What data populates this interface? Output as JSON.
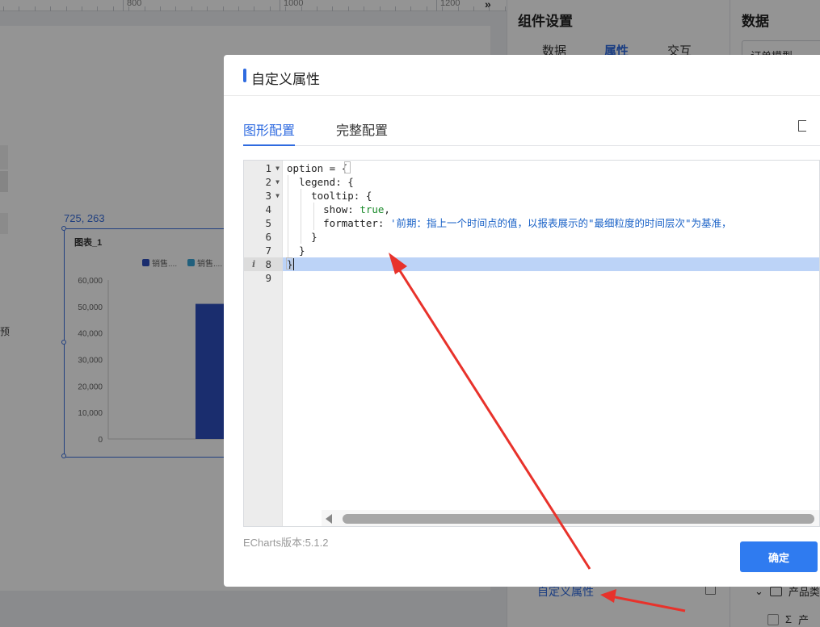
{
  "ruler": {
    "labels": [
      "800",
      "1000",
      "1200"
    ],
    "expand_icon": "»"
  },
  "canvas": {
    "left_cut_text": "预",
    "coord_label": "725, 263",
    "chart_title": "图表_1",
    "legend": [
      {
        "label": "销售....",
        "color": "#2e4fbd"
      },
      {
        "label": "销售....",
        "color": "#3aa6d8"
      }
    ]
  },
  "chart_data": {
    "type": "bar",
    "title": "图表_1",
    "yticks": [
      "60,000",
      "50,000",
      "40,000",
      "30,000",
      "20,000",
      "10,000",
      "0"
    ],
    "ylim": [
      0,
      60000
    ],
    "series": [
      {
        "name": "销售....",
        "color": "#2e4fbd",
        "values": [
          51000
        ]
      }
    ]
  },
  "right_panel": {
    "title": "组件设置",
    "tabs": [
      {
        "label": "数据",
        "active": false
      },
      {
        "label": "属性",
        "active": true
      },
      {
        "label": "交互",
        "active": false
      }
    ],
    "custom_prop_link": "自定义属性",
    "data_section": {
      "title": "数据",
      "dataset_select": "订单模型",
      "tree_row_1": "产品类",
      "tree_row_2": "产"
    }
  },
  "modal": {
    "title": "自定义属性",
    "tabs": [
      {
        "label": "图形配置",
        "active": true
      },
      {
        "label": "完整配置",
        "active": false
      }
    ],
    "code_lines": [
      "option = {",
      "  legend: {",
      "    tooltip: {",
      "      show: true,",
      "      formatter: '前期：指上一个时间点的值，以报表展示的\"最细粒度的时间层次\"为基准，",
      "    }",
      "  }",
      "}",
      ""
    ],
    "line_numbers": [
      "1",
      "2",
      "3",
      "4",
      "5",
      "6",
      "7",
      "8",
      "9"
    ],
    "active_line": 8,
    "echarts_version": "ECharts版本:5.1.2",
    "confirm_label": "确定"
  },
  "annotation_color": "#e8322b"
}
